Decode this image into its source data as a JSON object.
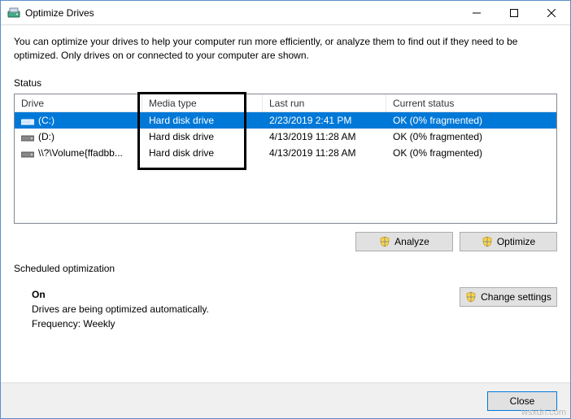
{
  "window": {
    "title": "Optimize Drives"
  },
  "description": "You can optimize your drives to help your computer run more efficiently, or analyze them to find out if they need to be optimized. Only drives on or connected to your computer are shown.",
  "status_label": "Status",
  "columns": {
    "drive": "Drive",
    "media": "Media type",
    "last": "Last run",
    "status": "Current status"
  },
  "rows": [
    {
      "drive": "(C:)",
      "media": "Hard disk drive",
      "last": "2/23/2019 2:41 PM",
      "status": "OK (0% fragmented)",
      "selected": true,
      "icon": "hdd"
    },
    {
      "drive": "(D:)",
      "media": "Hard disk drive",
      "last": "4/13/2019 11:28 AM",
      "status": "OK (0% fragmented)",
      "selected": false,
      "icon": "hdd"
    },
    {
      "drive": "\\\\?\\Volume{ffadbb...",
      "media": "Hard disk drive",
      "last": "4/13/2019 11:28 AM",
      "status": "OK (0% fragmented)",
      "selected": false,
      "icon": "hdd"
    }
  ],
  "buttons": {
    "analyze": "Analyze",
    "optimize": "Optimize",
    "change_settings": "Change settings",
    "close": "Close"
  },
  "scheduled": {
    "label": "Scheduled optimization",
    "on": "On",
    "desc": "Drives are being optimized automatically.",
    "freq": "Frequency: Weekly"
  },
  "watermark": "wsxdn.com"
}
